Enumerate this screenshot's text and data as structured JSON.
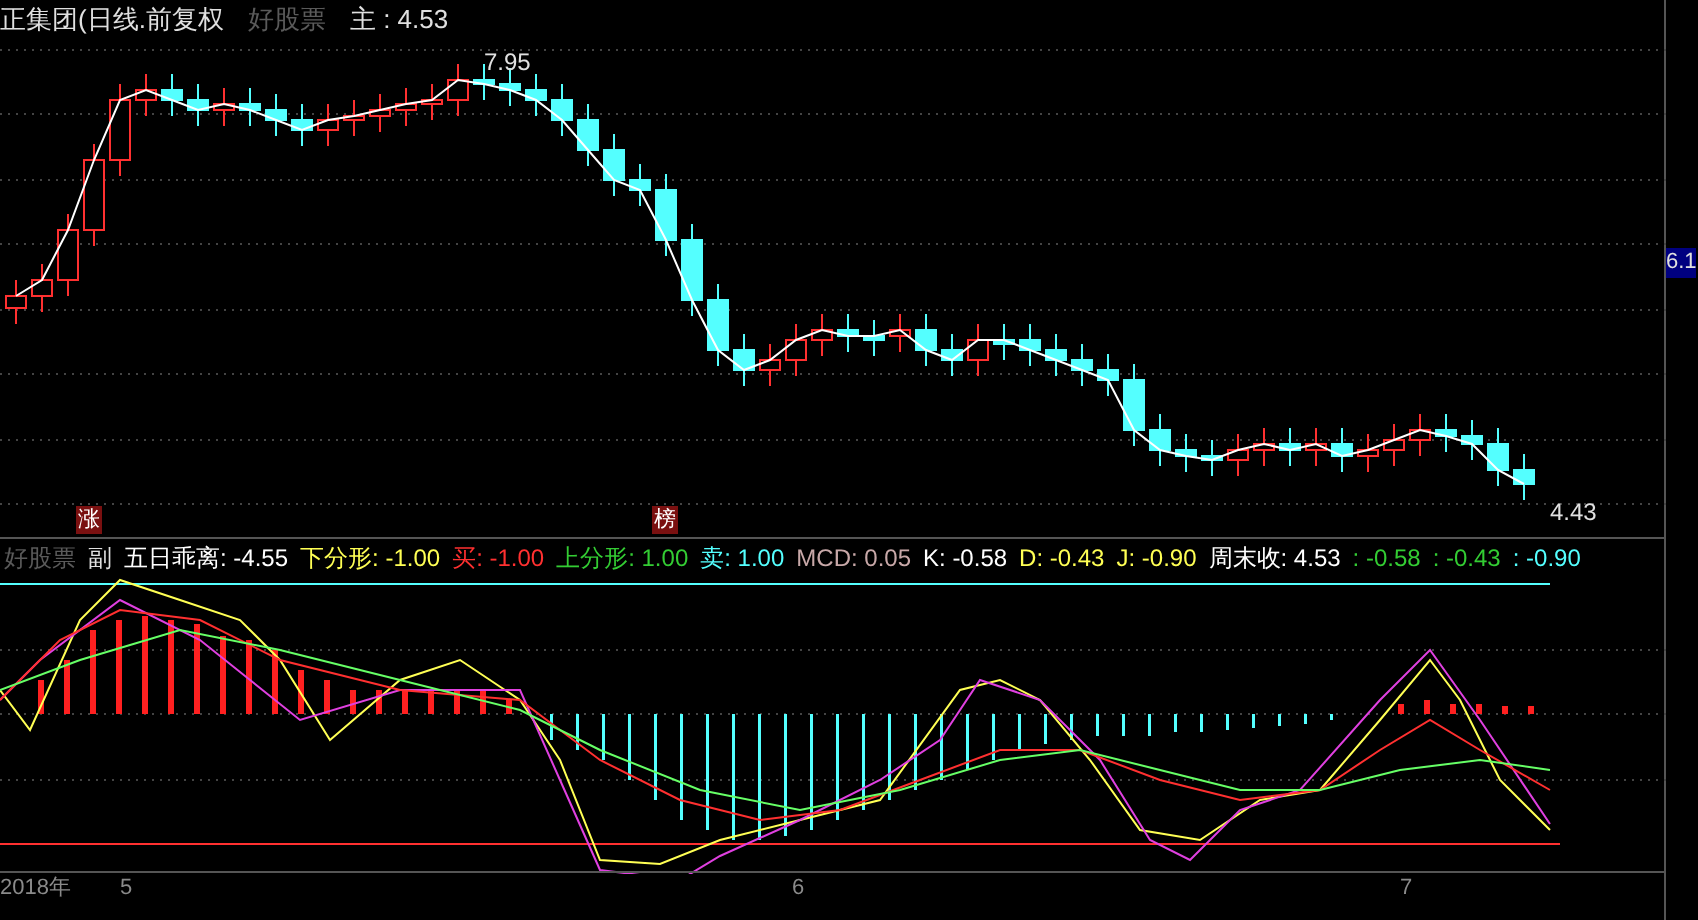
{
  "header": {
    "title": "正集团(日线.前复权",
    "tag": "好股票",
    "main_label": "主",
    "main_value": ": 4.53"
  },
  "price_labels": {
    "high": "7.95",
    "low": "4.43",
    "axis_value": "6.1"
  },
  "markers": [
    {
      "text": "涨"
    },
    {
      "text": "榜"
    }
  ],
  "indicator": {
    "tag": "好股票",
    "label": "副",
    "items": [
      {
        "text": "五日乖离: -4.55",
        "color": "#ffffff"
      },
      {
        "text": "下分形: -1.00",
        "color": "#ffff54"
      },
      {
        "text": "买: -1.00",
        "color": "#ff3030"
      },
      {
        "text": "上分形: 1.00",
        "color": "#33cc33"
      },
      {
        "text": "卖: 1.00",
        "color": "#54ffff"
      },
      {
        "text": "MCD: 0.05",
        "color": "#c8a8a8"
      },
      {
        "text": "K: -0.58",
        "color": "#ffffff"
      },
      {
        "text": "D: -0.43",
        "color": "#ffff54"
      },
      {
        "text": "J: -0.90",
        "color": "#ffff54"
      },
      {
        "text": "周末收: 4.53",
        "color": "#ffffff"
      },
      {
        "text": ": -0.58",
        "color": "#33cc33"
      },
      {
        "text": ": -0.43",
        "color": "#33cc33"
      },
      {
        "text": ": -0.90",
        "color": "#54ffff"
      }
    ]
  },
  "time_axis": [
    "2018年",
    "5",
    "6",
    "7"
  ]
}
